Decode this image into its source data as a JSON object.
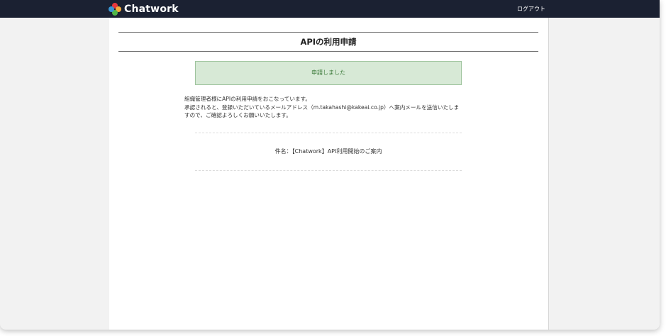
{
  "header": {
    "brand": "Chatwork",
    "logout_label": "ログアウト",
    "logo_colors": [
      "#e8383d",
      "#f6ad3c",
      "#51b848",
      "#3a96d5"
    ]
  },
  "main": {
    "title": "APIの利用申請",
    "notice": "申請しました",
    "message_line1": "組織管理者様にAPIの利用申請をおこなっています。",
    "message_line2": "承認されると、登録いただいているメールアドレス（m.takahashi@kakeai.co.jp）へ案内メールを送信いたしますので、ご確認よろしくお願いいたします。",
    "subject_label": "件名：",
    "subject_value": "【Chatwork】API利用開始のご案内"
  }
}
